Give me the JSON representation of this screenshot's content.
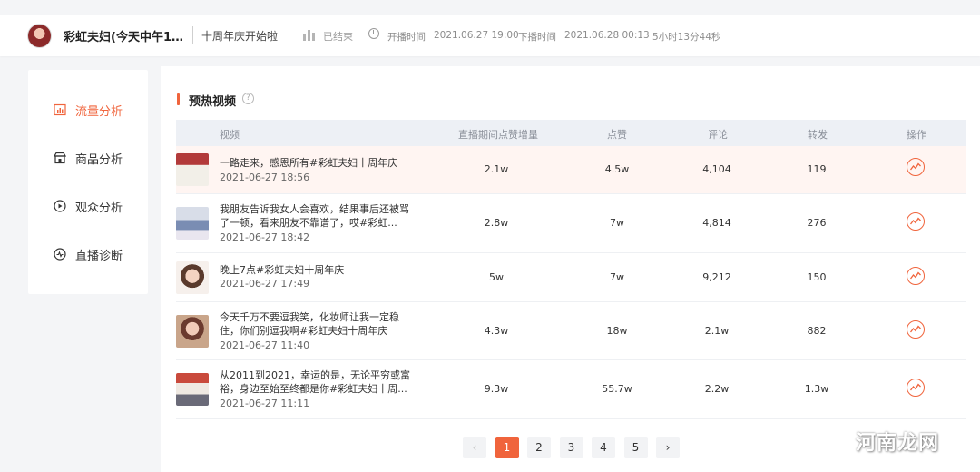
{
  "header": {
    "host_name": "彩虹夫妇(今天中午12...",
    "live_title": "十周年庆开始啦",
    "status": "已结束",
    "start_label": "开播时间",
    "start_time": "2021.06.27 19:00",
    "end_label": "下播时间",
    "end_time": "2021.06.28 00:13",
    "duration": "5小时13分44秒"
  },
  "sidebar": {
    "items": [
      {
        "label": "流量分析",
        "icon": "bar-chart-icon",
        "active": true
      },
      {
        "label": "商品分析",
        "icon": "shop-icon",
        "active": false
      },
      {
        "label": "观众分析",
        "icon": "play-circle-icon",
        "active": false
      },
      {
        "label": "直播诊断",
        "icon": "diagnose-icon",
        "active": false
      }
    ]
  },
  "section": {
    "title": "预热视频",
    "help": "?"
  },
  "table": {
    "headers": [
      "视频",
      "直播期间点赞增量",
      "点赞",
      "评论",
      "转发",
      "操作"
    ],
    "rows": [
      {
        "title": "一路走来，感恩所有#彩虹夫妇十周年庆",
        "date": "2021-06-27 18:56",
        "like_increase": "2.1w",
        "likes": "4.5w",
        "comments": "4,104",
        "shares": "119"
      },
      {
        "title": "我朋友告诉我女人会喜欢，结果事后还被骂了一顿，看来朋友不靠谱了，哎#彩虹...",
        "date": "2021-06-27 18:42",
        "like_increase": "2.8w",
        "likes": "7w",
        "comments": "4,814",
        "shares": "276"
      },
      {
        "title": "晚上7点#彩虹夫妇十周年庆",
        "date": "2021-06-27 17:49",
        "like_increase": "5w",
        "likes": "7w",
        "comments": "9,212",
        "shares": "150"
      },
      {
        "title": "今天千万不要逗我笑，化妆师让我一定稳住，你们别逗我啊#彩虹夫妇十周年庆",
        "date": "2021-06-27 11:40",
        "like_increase": "4.3w",
        "likes": "18w",
        "comments": "2.1w",
        "shares": "882"
      },
      {
        "title": "从2011到2021，幸运的是，无论平穷或富裕，身边至始至终都是你#彩虹夫妇十周...",
        "date": "2021-06-27 11:11",
        "like_increase": "9.3w",
        "likes": "55.7w",
        "comments": "2.2w",
        "shares": "1.3w"
      }
    ]
  },
  "pagination": {
    "prev": "‹",
    "pages": [
      "1",
      "2",
      "3",
      "4",
      "5"
    ],
    "next": "›",
    "current": "1"
  },
  "watermark": "河南龙网",
  "colors": {
    "accent": "#f0643c",
    "header_bg": "#ffffff",
    "table_head_bg": "#edf0f5",
    "highlight_row": "#fff5f2"
  }
}
